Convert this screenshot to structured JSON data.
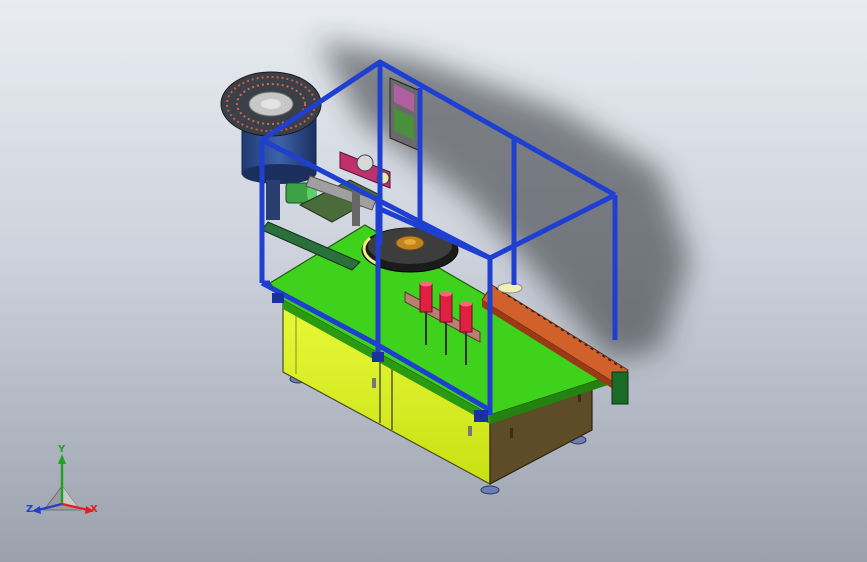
{
  "triad": {
    "x_label": "X",
    "y_label": "Y",
    "z_label": "Z",
    "x_color": "#e02020",
    "y_color": "#22a022",
    "z_color": "#2040d0"
  },
  "colors": {
    "frame": "#1e3fd0",
    "deck": "#3fd21d",
    "cabinet": "#ddf51e",
    "cabinet_side": "#5e4b28",
    "bowl": "#2c4c8c",
    "conveyor": "#d2602a"
  }
}
